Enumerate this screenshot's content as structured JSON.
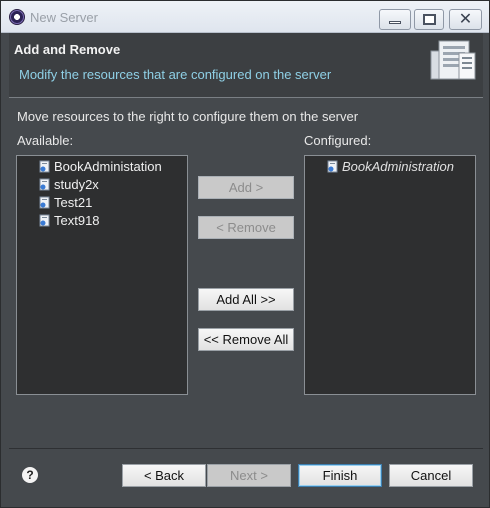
{
  "window": {
    "title": "New Server"
  },
  "header": {
    "title": "Add and Remove",
    "description": "Modify the resources that are configured on the server",
    "icon": "server-icon"
  },
  "main": {
    "instruction": "Move resources to the right to configure them on the server",
    "available_label": "Available:",
    "configured_label": "Configured:",
    "available_items": [
      "BookAdministation",
      "study2x",
      "Test21",
      "Text918"
    ],
    "configured_items": [
      "BookAdministration"
    ]
  },
  "actions": {
    "add": "Add >",
    "remove": "< Remove",
    "add_all": "Add All >>",
    "remove_all": "<< Remove All"
  },
  "footer": {
    "help": "?",
    "back": "< Back",
    "next": "Next >",
    "finish": "Finish",
    "cancel": "Cancel"
  },
  "colors": {
    "accent_text": "#8fd0e6",
    "list_bg": "#2e2f30",
    "dialog_bg": "#45494d"
  }
}
